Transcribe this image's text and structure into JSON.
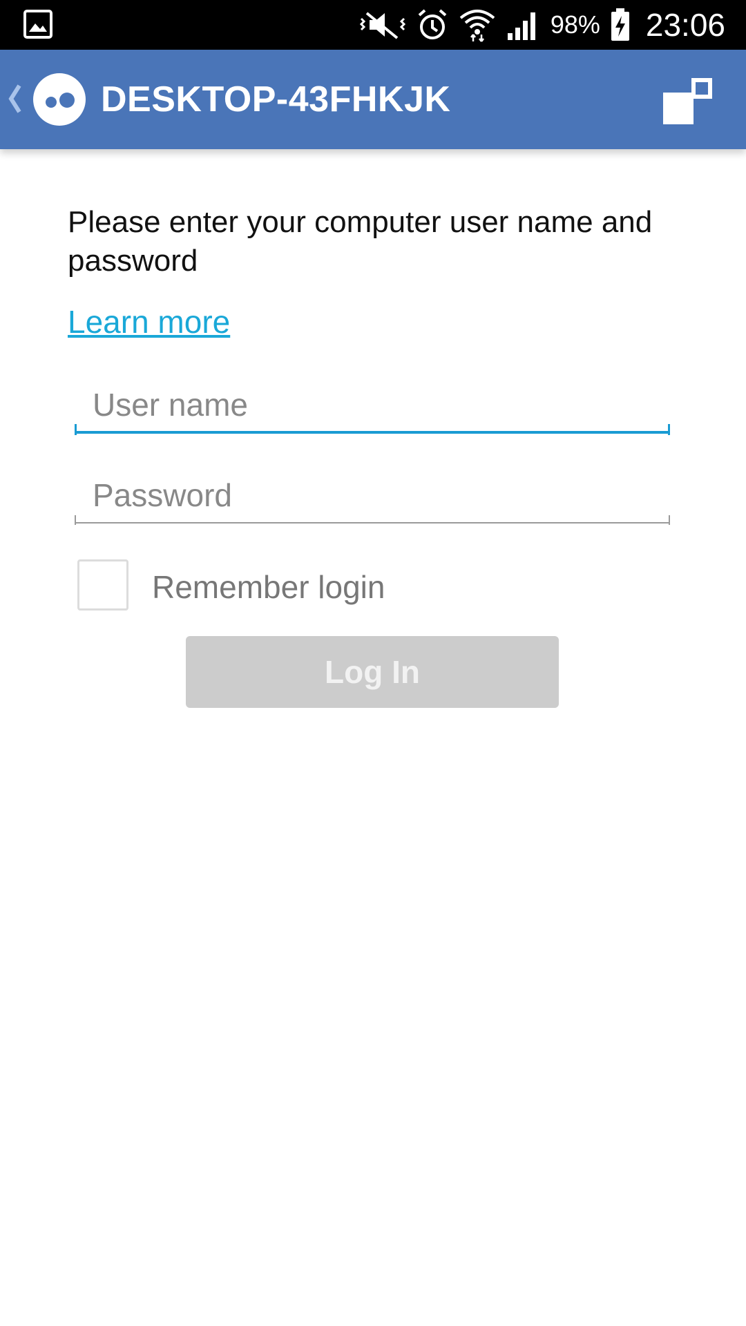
{
  "status_bar": {
    "battery": "98%",
    "clock": "23:06",
    "icons": [
      "gallery-icon",
      "mute-vibrate-icon",
      "alarm-icon",
      "wifi-icon",
      "signal-icon",
      "battery-charging-icon"
    ]
  },
  "app_bar": {
    "title": "DESKTOP-43FHKJK",
    "background_color": "#4a75b8",
    "icons": [
      "back-chevron-icon",
      "app-logo-icon",
      "window-switch-icon"
    ]
  },
  "login": {
    "instruction": "Please enter your computer user name and password",
    "learn_more": "Learn more",
    "username_placeholder": "User name",
    "username_value": "",
    "password_placeholder": "Password",
    "password_value": "",
    "remember_label": "Remember login",
    "remember_checked": false,
    "login_button": "Log In",
    "accent_color": "#199bd3",
    "link_color": "#1aa8d8"
  }
}
